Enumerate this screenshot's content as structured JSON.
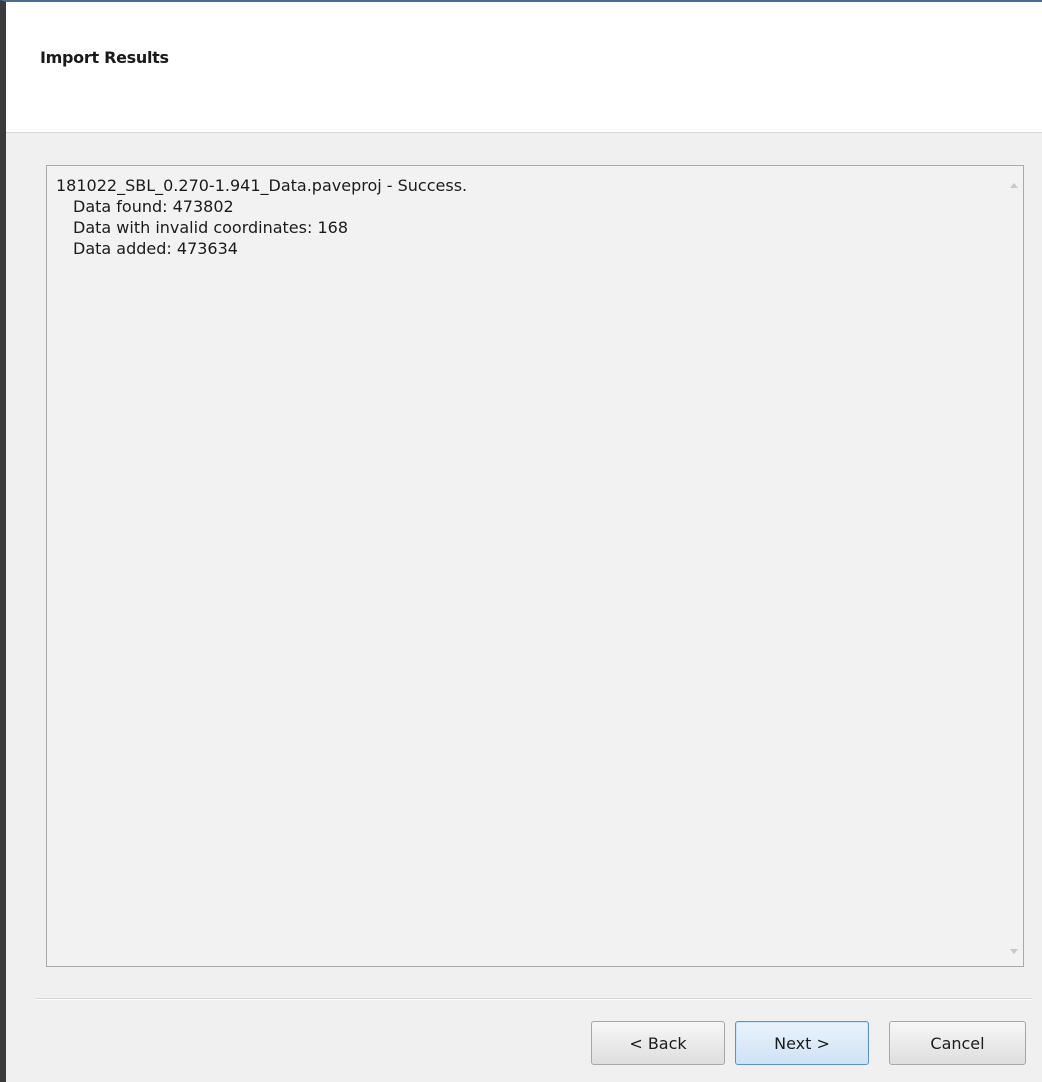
{
  "header": {
    "title": "Import Results"
  },
  "results": {
    "lines": [
      "181022_SBL_0.270-1.941_Data.paveproj - Success.",
      "Data found: 473802",
      "Data with invalid coordinates: 168",
      "Data added: 473634"
    ],
    "scroll_up_icon": "chevron-up-icon",
    "scroll_down_icon": "chevron-down-icon"
  },
  "buttons": {
    "back_label": "< Back",
    "next_label": "Next >",
    "cancel_label": "Cancel"
  },
  "colors": {
    "header_bg": "#ffffff",
    "body_bg": "#f0f0f0",
    "results_bg": "#f2f2f3",
    "default_button_border": "#5c93cc"
  }
}
